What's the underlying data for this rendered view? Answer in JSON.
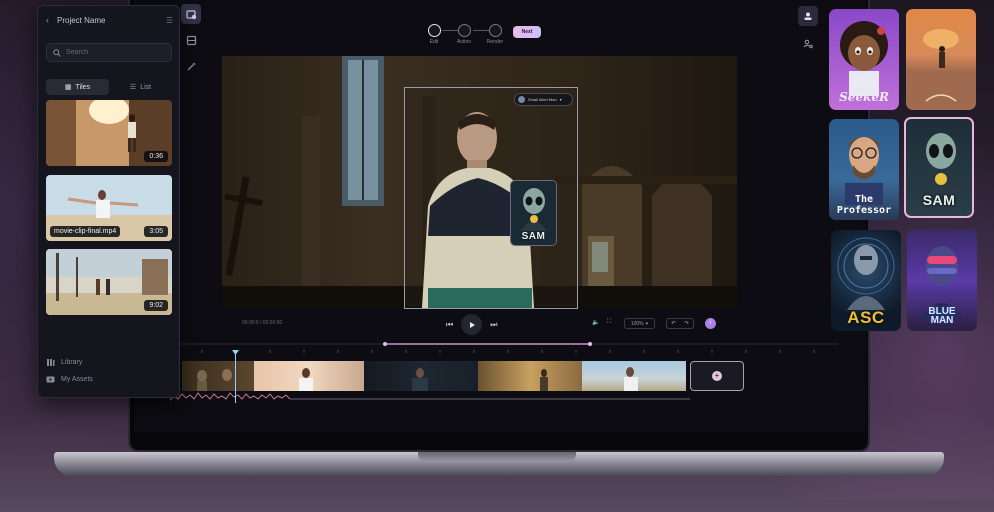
{
  "project": {
    "title": "Project Name",
    "search_placeholder": "Search",
    "view_tiles": "Tiles",
    "view_list": "List",
    "clips": [
      {
        "duration": "0:36",
        "name": ""
      },
      {
        "duration": "3:05",
        "name": "movie-clip-final.mp4"
      },
      {
        "duration": "9:02",
        "name": ""
      }
    ],
    "footer": [
      {
        "label": "Library",
        "icon": "library-icon"
      },
      {
        "label": "My Assets",
        "icon": "assets-icon"
      }
    ]
  },
  "steps": [
    {
      "label": "Edit",
      "active": true
    },
    {
      "label": "Action",
      "active": false
    },
    {
      "label": "Render",
      "active": false
    }
  ],
  "next_label": "Next",
  "voice_label": "Small Alien Man",
  "preview": {
    "time": "00:00:0 / 00:02:00",
    "zoom": "100%",
    "info": "i"
  },
  "characters": [
    {
      "caption": "The SeekeR",
      "name": "seeker"
    },
    {
      "caption": "",
      "name": "desert-wanderer"
    },
    {
      "caption": "The Professor",
      "name": "professor"
    },
    {
      "caption": "SAM",
      "name": "sam",
      "selected": true
    },
    {
      "caption": "ASC",
      "name": "asc"
    },
    {
      "caption": "BLUE MAN",
      "name": "blue-man"
    }
  ],
  "sam_card_caption": "SAM",
  "colors": {
    "accent": "#a880e8",
    "next_gradient_start": "#f0b8e8",
    "selected_border": "#e8b8d8",
    "playhead": "#9ad0f0"
  }
}
